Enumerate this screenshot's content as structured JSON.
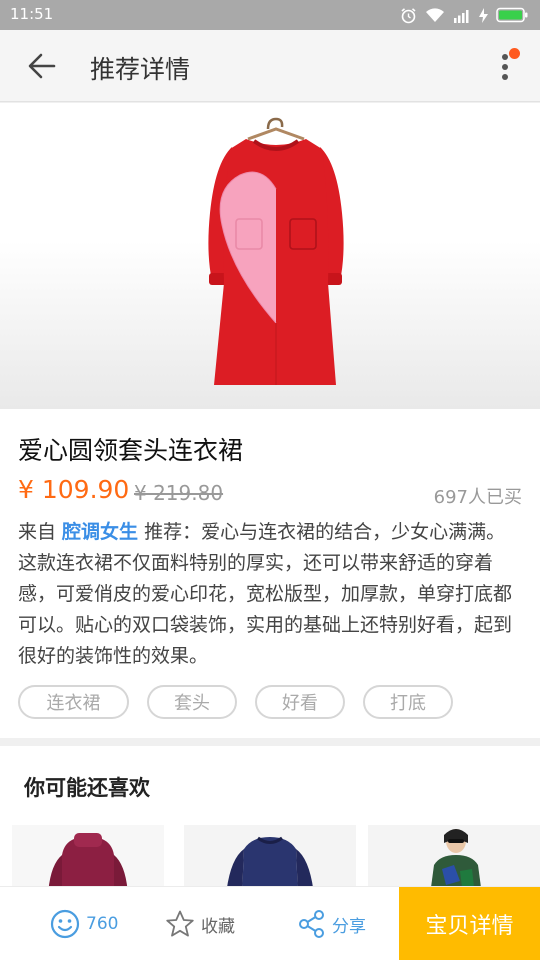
{
  "status_bar": {
    "time": "11:51"
  },
  "header": {
    "title": "推荐详情"
  },
  "product": {
    "title": "爱心圆领套头连衣裙",
    "price": "¥ 109.90",
    "original_price": "¥ 219.80",
    "sold": "697人已买",
    "source_prefix": "来自 ",
    "source_name": "腔调女生",
    "description": " 推荐：爱心与连衣裙的结合，少女心满满。这款连衣裙不仅面料特别的厚实，还可以带来舒适的穿着感，可爱俏皮的爱心印花，宽松版型，加厚款，单穿打底都可以。贴心的双口袋装饰，实用的基础上还特别好看，起到很好的装饰性的效果。",
    "tags": [
      "连衣裙",
      "套头",
      "好看",
      "打底"
    ]
  },
  "recommendations": {
    "title": "你可能还喜欢"
  },
  "bottom_bar": {
    "like_count": "760",
    "favorite_label": "收藏",
    "share_label": "分享",
    "detail_button_label": "宝贝详情"
  },
  "colors": {
    "accent": "#ff6a13",
    "link": "#3a8ee6",
    "cta": "#ffbb00",
    "icon_blue": "#4a9de0"
  },
  "icons": [
    "alarm-icon",
    "wifi-icon",
    "signal-icon",
    "battery-icon",
    "back-arrow-icon",
    "more-vertical-icon",
    "smiley-icon",
    "star-icon",
    "share-icon"
  ]
}
